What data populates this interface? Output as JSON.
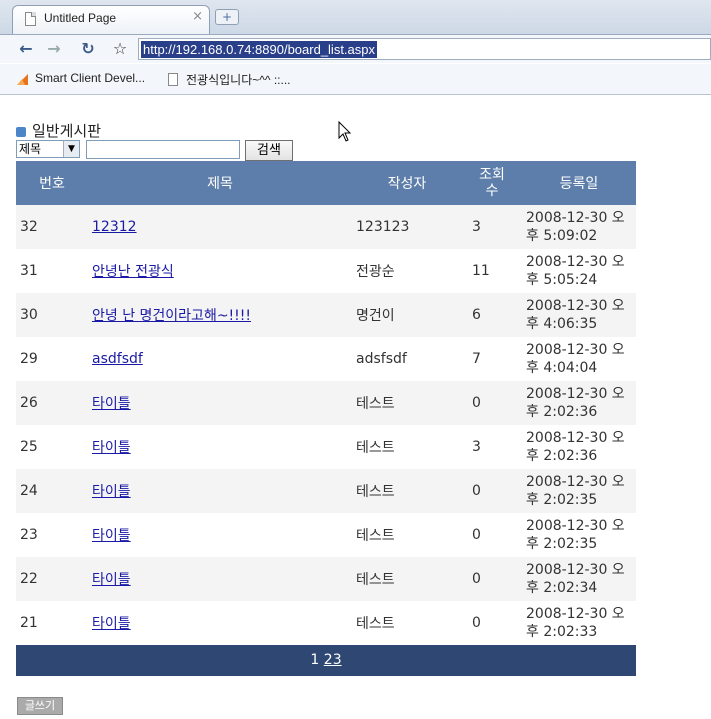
{
  "browser": {
    "tab_title": "Untitled Page",
    "tab_close": "×",
    "url": "http://192.168.0.74:8890/board_list.aspx",
    "bookmarks": [
      "Smart Client Devel...",
      "전광식입니다~^^ ::..."
    ]
  },
  "board": {
    "title": "일반게시판",
    "search": {
      "select_value": "제목",
      "button_label": "검색"
    },
    "columns": [
      "번호",
      "제목",
      "작성자",
      "조회수",
      "등록일"
    ],
    "columns_views_line1": "조회",
    "columns_views_line2": "수",
    "rows": [
      {
        "no": "32",
        "title": "12312",
        "author": "123123",
        "views": "3",
        "date1": "2008-12-30 오",
        "date2": "후 5:09:02"
      },
      {
        "no": "31",
        "title": "안녕난 전광식",
        "author": "전광순",
        "views": "11",
        "date1": "2008-12-30 오",
        "date2": "후 5:05:24"
      },
      {
        "no": "30",
        "title": "안녕 난 명건이라고해~!!!!",
        "author": "명건이",
        "views": "6",
        "date1": "2008-12-30 오",
        "date2": "후 4:06:35"
      },
      {
        "no": "29",
        "title": "asdfsdf",
        "author": "adsfsdf",
        "views": "7",
        "date1": "2008-12-30 오",
        "date2": "후 4:04:04"
      },
      {
        "no": "26",
        "title": "타이틀",
        "author": "테스트",
        "views": "0",
        "date1": "2008-12-30 오",
        "date2": "후 2:02:36"
      },
      {
        "no": "25",
        "title": "타이틀",
        "author": "테스트",
        "views": "3",
        "date1": "2008-12-30 오",
        "date2": "후 2:02:36"
      },
      {
        "no": "24",
        "title": "타이틀",
        "author": "테스트",
        "views": "0",
        "date1": "2008-12-30 오",
        "date2": "후 2:02:35"
      },
      {
        "no": "23",
        "title": "타이틀",
        "author": "테스트",
        "views": "0",
        "date1": "2008-12-30 오",
        "date2": "후 2:02:35"
      },
      {
        "no": "22",
        "title": "타이틀",
        "author": "테스트",
        "views": "0",
        "date1": "2008-12-30 오",
        "date2": "후 2:02:34"
      },
      {
        "no": "21",
        "title": "타이틀",
        "author": "테스트",
        "views": "0",
        "date1": "2008-12-30 오",
        "date2": "후 2:02:33"
      }
    ],
    "pager": {
      "current": "1",
      "pages": [
        "2",
        "3"
      ]
    },
    "write_button": "글쓰기"
  },
  "colors": {
    "header_bg": "#5d7eaa",
    "pager_bg": "#2e4773",
    "link": "#1a1aa6"
  }
}
